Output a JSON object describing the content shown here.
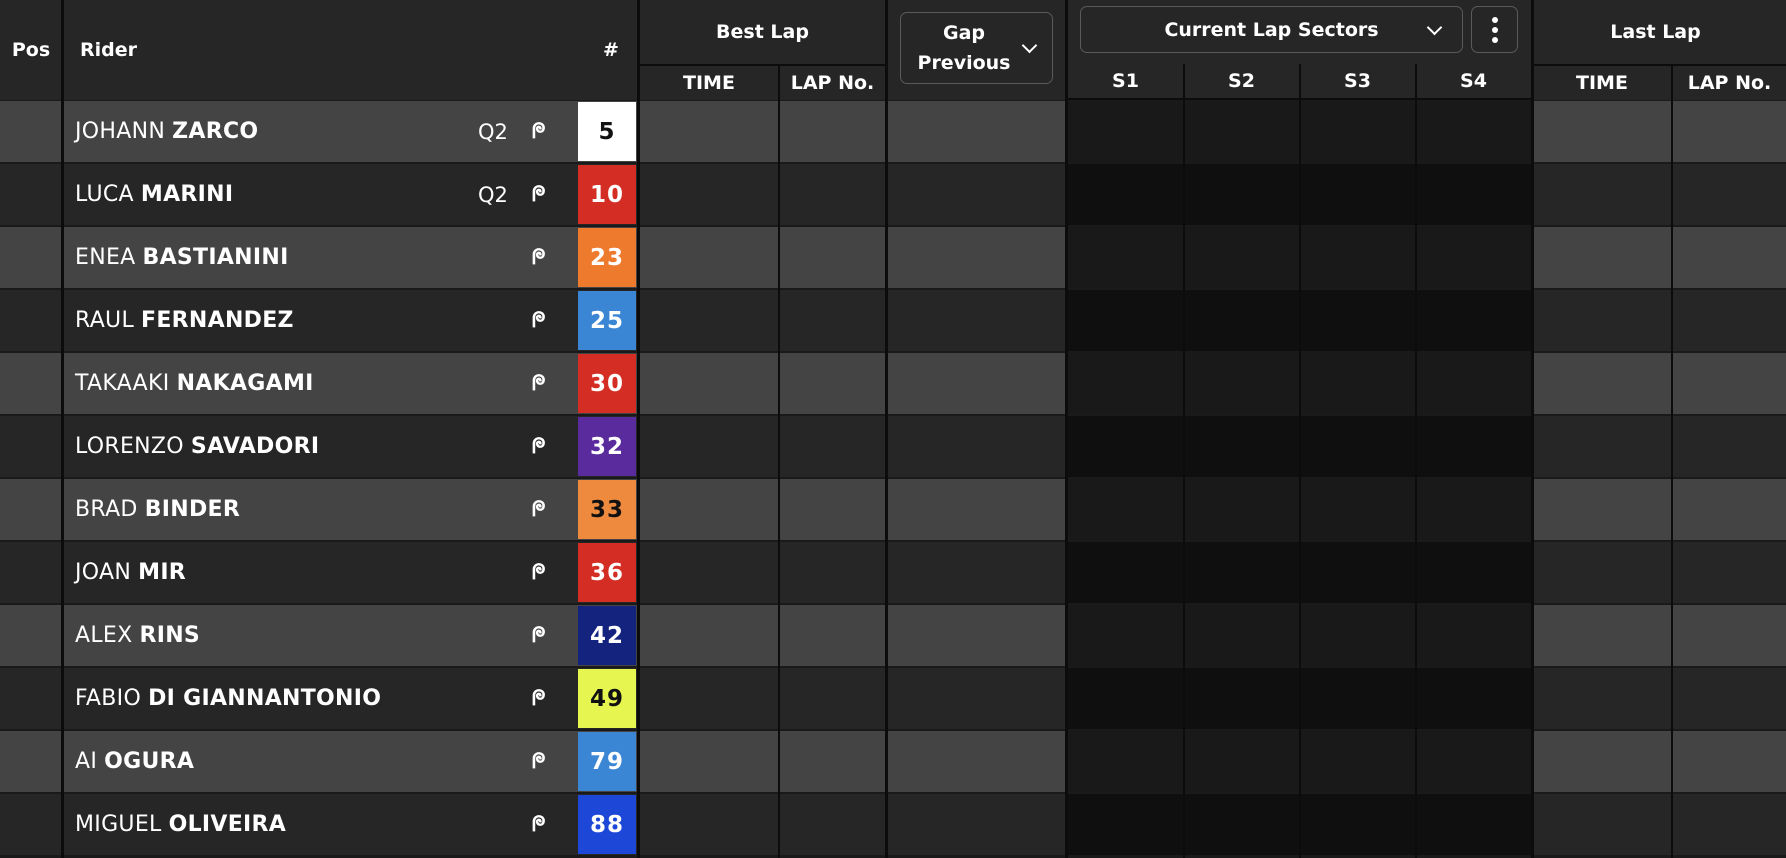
{
  "header": {
    "pos": "Pos",
    "rider": "Rider",
    "number": "#",
    "best_lap": "Best Lap",
    "best_time": "TIME",
    "best_lap_no": "LAP No.",
    "gap_line1": "Gap",
    "gap_line2": "Previous",
    "sectors_select": "Current Lap Sectors",
    "s1": "S1",
    "s2": "S2",
    "s3": "S3",
    "s4": "S4",
    "last_lap": "Last Lap",
    "last_time": "TIME",
    "last_lap_no": "LAP No.",
    "icons": {
      "gap_dropdown": "chevron-down-icon",
      "sectors_dropdown": "chevron-down-icon",
      "more": "more-vertical-icon",
      "status": "pit-flag-icon"
    }
  },
  "riders": [
    {
      "first": "JOHANN",
      "last": "ZARCO",
      "q2": "Q2",
      "flag": "ᖘ",
      "number": "5",
      "num_bg": "#ffffff",
      "num_fg": "#111111"
    },
    {
      "first": "LUCA",
      "last": "MARINI",
      "q2": "Q2",
      "flag": "ᖘ",
      "number": "10",
      "num_bg": "#d42d24",
      "num_fg": "#ffffff"
    },
    {
      "first": "ENEA",
      "last": "BASTIANINI",
      "q2": "",
      "flag": "ᖘ",
      "number": "23",
      "num_bg": "#ee7a2e",
      "num_fg": "#ffffff"
    },
    {
      "first": "RAUL",
      "last": "FERNANDEZ",
      "q2": "",
      "flag": "ᖘ",
      "number": "25",
      "num_bg": "#3a86d4",
      "num_fg": "#ffffff"
    },
    {
      "first": "TAKAAKI",
      "last": "NAKAGAMI",
      "q2": "",
      "flag": "ᖘ",
      "number": "30",
      "num_bg": "#d42d24",
      "num_fg": "#ffffff"
    },
    {
      "first": "LORENZO",
      "last": "SAVADORI",
      "q2": "",
      "flag": "ᖘ",
      "number": "32",
      "num_bg": "#5a2b9c",
      "num_fg": "#ffffff"
    },
    {
      "first": "BRAD",
      "last": "BINDER",
      "q2": "",
      "flag": "ᖘ",
      "number": "33",
      "num_bg": "#ee8a3e",
      "num_fg": "#111111"
    },
    {
      "first": "JOAN",
      "last": "MIR",
      "q2": "",
      "flag": "ᖘ",
      "number": "36",
      "num_bg": "#d42d24",
      "num_fg": "#ffffff"
    },
    {
      "first": "ALEX",
      "last": "RINS",
      "q2": "",
      "flag": "ᖘ",
      "number": "42",
      "num_bg": "#14237e",
      "num_fg": "#ffffff"
    },
    {
      "first": "FABIO",
      "last": "DI GIANNANTONIO",
      "q2": "",
      "flag": "ᖘ",
      "number": "49",
      "num_bg": "#e6f550",
      "num_fg": "#111111"
    },
    {
      "first": "AI",
      "last": "OGURA",
      "q2": "",
      "flag": "ᖘ",
      "number": "79",
      "num_bg": "#3a86d4",
      "num_fg": "#ffffff"
    },
    {
      "first": "MIGUEL",
      "last": "OLIVEIRA",
      "q2": "",
      "flag": "ᖘ",
      "number": "88",
      "num_bg": "#1d47d6",
      "num_fg": "#ffffff"
    }
  ]
}
